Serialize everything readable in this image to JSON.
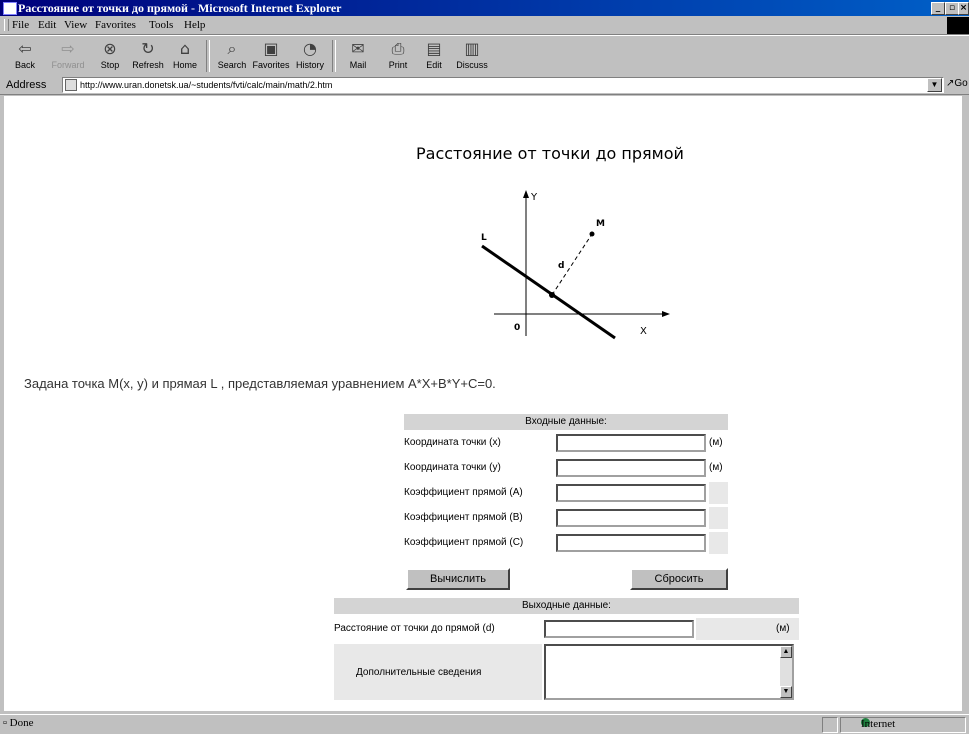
{
  "window": {
    "title": "Расстояние от точки до прямой - Microsoft Internet Explorer",
    "controls": [
      "_",
      "▫",
      "×"
    ]
  },
  "menu": [
    "File",
    "Edit",
    "View",
    "Favorites",
    "Tools",
    "Help"
  ],
  "toolbar": [
    {
      "label": "Back",
      "icon": "back-arrow-icon"
    },
    {
      "label": "Forward",
      "icon": "forward-arrow-icon",
      "disabled": true
    },
    {
      "label": "Stop",
      "icon": "stop-icon"
    },
    {
      "label": "Refresh",
      "icon": "refresh-icon"
    },
    {
      "label": "Home",
      "icon": "home-icon"
    },
    {
      "label": "Search",
      "icon": "search-icon"
    },
    {
      "label": "Favorites",
      "icon": "favorites-icon"
    },
    {
      "label": "History",
      "icon": "history-icon"
    },
    {
      "label": "Mail",
      "icon": "mail-icon"
    },
    {
      "label": "Print",
      "icon": "print-icon"
    },
    {
      "label": "Edit",
      "icon": "edit-icon"
    },
    {
      "label": "Discuss",
      "icon": "discuss-icon"
    }
  ],
  "address": {
    "label": "Address",
    "url": "http://www.uran.donetsk.ua/~students/fvti/calc/main/math/2.htm",
    "go": "Go"
  },
  "page": {
    "title": "Расстояние от точки до прямой",
    "diagram": {
      "y_axis": "Y",
      "x_axis": "X",
      "origin": "0",
      "line": "L",
      "point": "M",
      "distance": "d"
    },
    "problem": "Задана точка M(x, y) и прямая L , представляемая уравнением A*X+B*Y+C=0.",
    "input": {
      "header": "Входные данные:",
      "rows": [
        {
          "label": "Координата точки (x)",
          "value": "",
          "unit": "(м)"
        },
        {
          "label": "Координата точки (y)",
          "value": "",
          "unit": "(м)"
        },
        {
          "label": "Коэффициент прямой (A)",
          "value": "",
          "unit": ""
        },
        {
          "label": "Коэффициент прямой (B)",
          "value": "",
          "unit": ""
        },
        {
          "label": "Коэффициент прямой (C)",
          "value": "",
          "unit": ""
        }
      ],
      "calculate_label": "Вычислить",
      "reset_label": "Сбросить"
    },
    "output": {
      "header": "Выходные данные:",
      "distance_label": "Расстояние от точки до прямой (d)",
      "distance_value": "",
      "distance_unit": "(м)",
      "extra_label": "Дополнительные сведения",
      "extra_value": ""
    }
  },
  "status": {
    "text": "Done",
    "zone": "Internet"
  }
}
